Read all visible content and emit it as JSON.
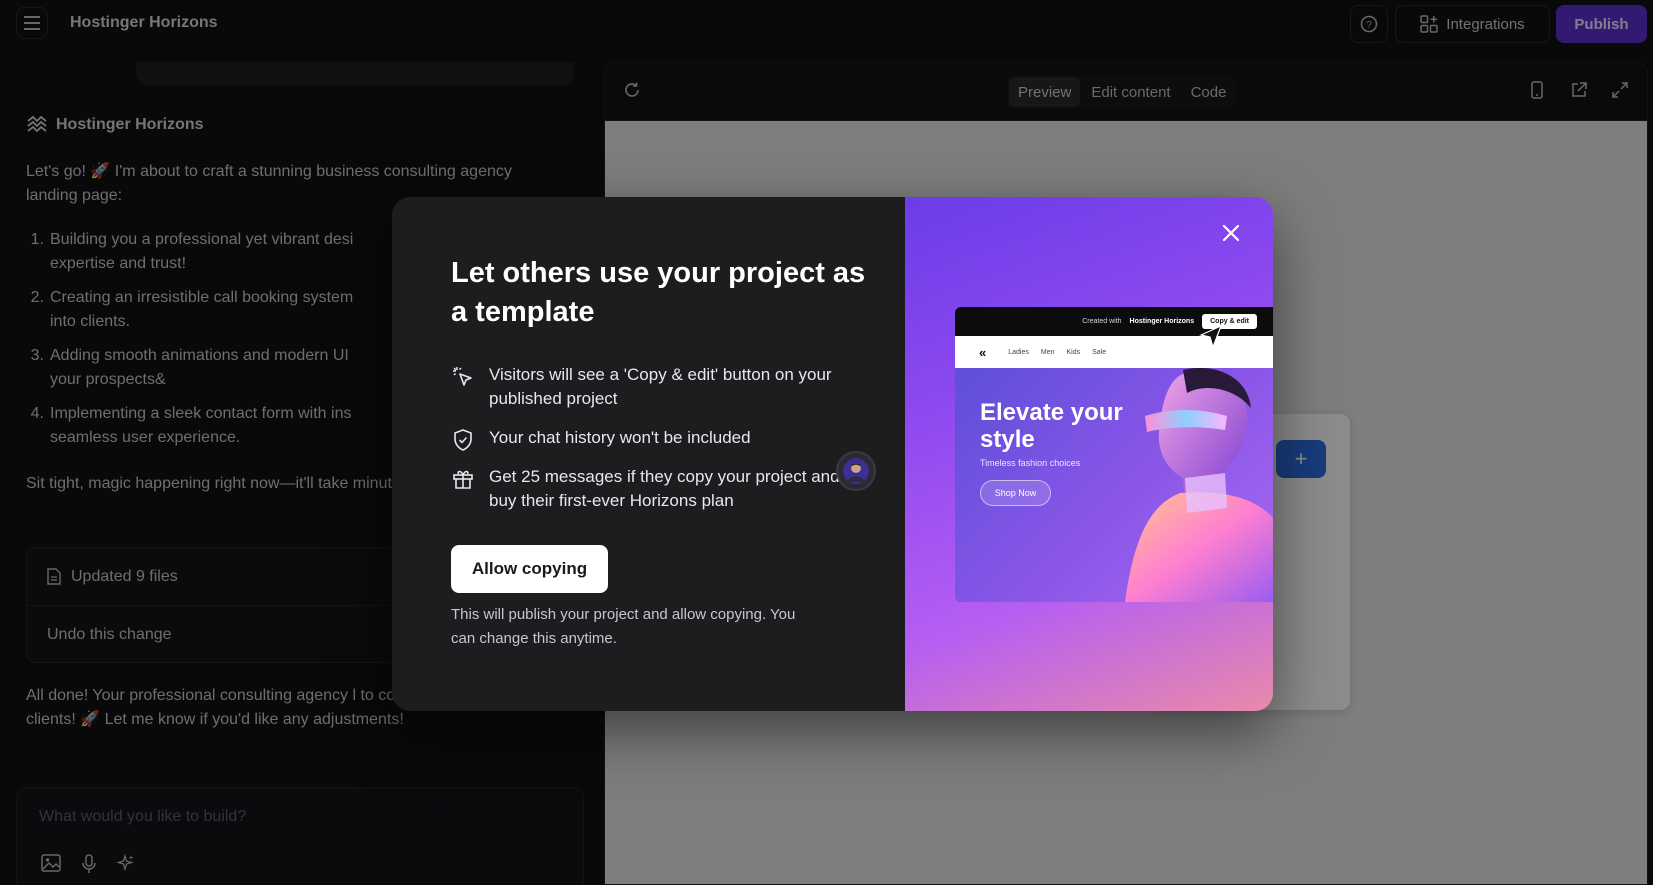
{
  "topbar": {
    "app_title": "Hostinger Horizons",
    "integrations_label": "Integrations",
    "publish_label": "Publish"
  },
  "chat": {
    "assistant_name": "Hostinger Horizons",
    "intro": "Let's go! 🚀 I'm about to craft a stunning business consulting agency landing page:",
    "steps": [
      {
        "num": "1.",
        "text": "Building you a professional yet vibrant desi",
        "text2": "expertise and trust!"
      },
      {
        "num": "2.",
        "text": "Creating an irresistible call booking system",
        "text2": "into clients."
      },
      {
        "num": "3.",
        "text": "Adding smooth animations and modern UI",
        "text2": "your prospects&"
      },
      {
        "num": "4.",
        "text": "Implementing a sleek contact form with ins",
        "text2": "seamless user experience."
      }
    ],
    "sit_tight": "Sit tight, magic happening right now—it'll take minutes! 🔥",
    "files_label": "Updated 9 files",
    "undo_label": "Undo this change",
    "done": "All done! Your professional consulting agency l to convert visitors into clients! 🚀 Let me know if you'd like any adjustments!",
    "composer_placeholder": "What would you like to build?"
  },
  "preview": {
    "tabs": [
      {
        "label": "Preview",
        "active": true
      },
      {
        "label": "Edit content",
        "active": false
      },
      {
        "label": "Code",
        "active": false
      }
    ],
    "ghost_plus": "+"
  },
  "modal": {
    "title": "Let others use your project as a template",
    "features": [
      {
        "icon": "cursor-sparkle-icon",
        "text": "Visitors will see a 'Copy & edit' button on your published project"
      },
      {
        "icon": "shield-check-icon",
        "text": "Your chat history won't be included"
      },
      {
        "icon": "gift-icon",
        "text": "Get 25 messages if they copy your project and buy their first-ever Horizons plan"
      }
    ],
    "allow_label": "Allow copying",
    "note": "This will publish your project and allow copying. You can change this anytime.",
    "mock": {
      "created_with": "Created with",
      "brand": "Hostinger Horizons",
      "copy_edit": "Copy & edit",
      "logo": "«",
      "nav": [
        "Ladies",
        "Men",
        "Kids",
        "Sale"
      ],
      "heading": "Elevate your style",
      "subheading": "Timeless fashion choices",
      "shop": "Shop Now"
    }
  },
  "colors": {
    "publish": "#5b2fd0",
    "modal_bg": "#1d1d20",
    "gradient_start": "#6a3de8",
    "gradient_end": "#e98aaa"
  }
}
